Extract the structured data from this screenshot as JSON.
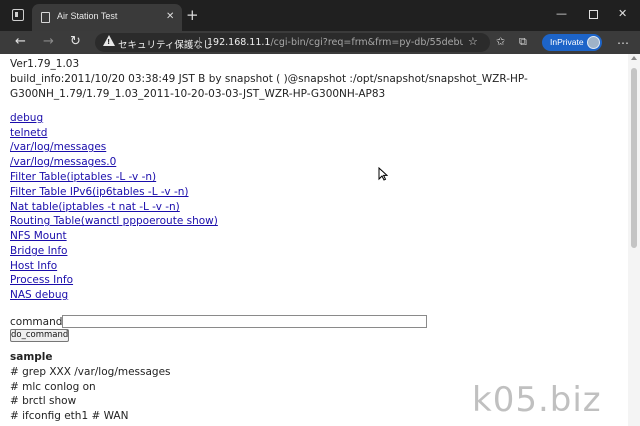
{
  "browser": {
    "tab_title": "Air Station Test",
    "tab_close": "✕",
    "new_tab": "+",
    "window_min": "—",
    "window_close": "✕",
    "security_label": "セキュリティ保護なし",
    "url_host": "192.168.11.1",
    "url_path": "/cgi-bin/cgi?req=frm&frm=py-db/55debu...",
    "inprivate_label": "InPrivate",
    "icons": {
      "back": "←",
      "forward": "→",
      "reload": "↻",
      "star": "☆",
      "collections": "⧉",
      "favorites": "✩",
      "extensions": "⊕",
      "menu": "…"
    }
  },
  "page": {
    "version": "Ver1.79_1.03",
    "build_info_line1": "build_info:2011/10/20 03:38:49 JST B by snapshot ( )@snapshot :/opt/snapshot/snapshot_WZR-HP-",
    "build_info_line2": "G300NH_1.79/1.79_1.03_2011-10-20-03-03-JST_WZR-HP-G300NH-AP83",
    "links": [
      "debug",
      "telnetd",
      "/var/log/messages",
      "/var/log/messages.0",
      "Filter Table(iptables -L -v -n)",
      "Filter Table IPv6(ip6tables -L -v -n)",
      "Nat table(iptables -t nat -L -v -n)",
      "Routing Table(wanctl pppoeroute show)",
      "NFS Mount",
      "Bridge Info",
      "Host Info",
      "Process Info",
      "NAS debug"
    ],
    "command_label": "command",
    "command_value": "",
    "do_command_label": "do_command",
    "sample_heading": "sample",
    "sample_lines": [
      "# grep XXX /var/log/messages",
      "# mlc conlog on",
      "# brctl show",
      "# ifconfig eth1 # WAN"
    ]
  },
  "watermark": "k05.biz",
  "colors": {
    "link": "#1a0dab",
    "inprivate": "#1d64c8",
    "tabbar": "#202020",
    "toolbar": "#3b3b3b"
  }
}
